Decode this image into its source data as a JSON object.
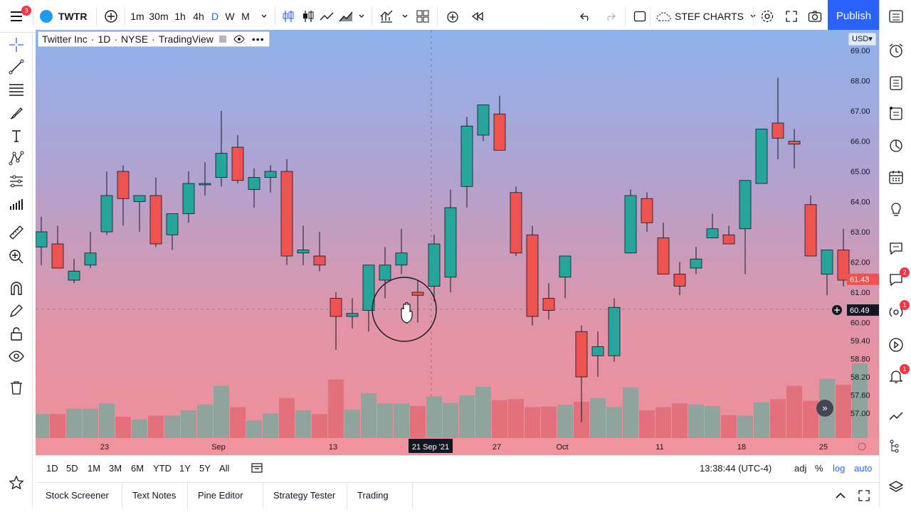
{
  "toolbar": {
    "menu_badge": "3",
    "symbol": "TWTR",
    "intervals": [
      "1m",
      "30m",
      "1h",
      "4h",
      "D",
      "W",
      "M"
    ],
    "active_interval": "D",
    "layout_name": "STEF CHARTS",
    "publish_label": "Publish"
  },
  "legend": {
    "name": "Twitter Inc",
    "interval": "1D",
    "exchange": "NYSE",
    "source": "TradingView"
  },
  "price_scale": {
    "currency": "USD",
    "labels": [
      "69.00",
      "68.00",
      "67.00",
      "66.00",
      "65.00",
      "64.00",
      "63.00",
      "62.00",
      "61.00",
      "60.00",
      "59.40",
      "58.80",
      "58.20",
      "57.60",
      "57.00"
    ],
    "last_price": "61.43",
    "cursor_price": "60.49"
  },
  "time_axis": {
    "labels": [
      "23",
      "Sep",
      "13",
      "27",
      "Oct",
      "11",
      "18",
      "25"
    ],
    "cursor_label": "21 Sep '21"
  },
  "ranges": [
    "1D",
    "5D",
    "1M",
    "3M",
    "6M",
    "YTD",
    "1Y",
    "5Y",
    "All"
  ],
  "clock": "13:38:44 (UTC-4)",
  "scale_options": [
    "adj",
    "%",
    "log",
    "auto"
  ],
  "tabs": [
    "Stock Screener",
    "Text Notes",
    "Pine Editor",
    "Strategy Tester",
    "Trading Panel"
  ],
  "right_badges": {
    "chat": "2",
    "streams": "1",
    "alerts": "1"
  },
  "colors": {
    "up": "#26a69a",
    "down": "#ef5350",
    "accent": "#2962ff"
  },
  "chart_data": {
    "type": "candlestick",
    "columns": [
      "open",
      "high",
      "low",
      "close"
    ],
    "candles": [
      [
        62.5,
        63.5,
        61.9,
        63.0
      ],
      [
        62.6,
        63.2,
        61.8,
        61.8
      ],
      [
        61.4,
        62.1,
        61.3,
        61.7
      ],
      [
        61.9,
        63.0,
        61.8,
        62.3
      ],
      [
        63.0,
        65.0,
        62.9,
        64.2
      ],
      [
        65.0,
        65.2,
        63.2,
        64.1
      ],
      [
        64.0,
        64.2,
        63.0,
        64.2
      ],
      [
        64.2,
        64.8,
        62.5,
        62.6
      ],
      [
        62.9,
        63.6,
        62.4,
        63.6
      ],
      [
        63.6,
        65.0,
        63.3,
        64.6
      ],
      [
        64.6,
        65.3,
        64.2,
        64.6
      ],
      [
        64.8,
        67.0,
        64.5,
        65.6
      ],
      [
        65.8,
        66.2,
        64.6,
        64.7
      ],
      [
        64.4,
        65.1,
        63.8,
        64.8
      ],
      [
        64.8,
        65.2,
        64.3,
        65.0
      ],
      [
        65.0,
        65.4,
        61.9,
        62.2
      ],
      [
        62.3,
        63.2,
        61.9,
        62.4
      ],
      [
        62.2,
        63.0,
        61.7,
        61.9
      ],
      [
        60.8,
        61.0,
        59.1,
        60.2
      ],
      [
        60.2,
        60.8,
        59.8,
        60.3
      ],
      [
        60.4,
        61.9,
        59.7,
        61.9
      ],
      [
        61.4,
        62.5,
        60.8,
        61.9
      ],
      [
        61.9,
        63.1,
        61.6,
        62.3
      ],
      [
        61.0,
        61.4,
        60.0,
        60.9
      ],
      [
        61.2,
        62.9,
        60.7,
        62.6
      ],
      [
        61.5,
        64.4,
        61.0,
        63.8
      ],
      [
        64.5,
        66.8,
        63.8,
        66.5
      ],
      [
        66.2,
        67.2,
        66.0,
        67.2
      ],
      [
        66.9,
        67.5,
        66.0,
        65.7
      ],
      [
        64.3,
        64.5,
        62.2,
        62.3
      ],
      [
        62.9,
        63.2,
        59.9,
        60.2
      ],
      [
        60.8,
        61.3,
        60.1,
        60.4
      ],
      [
        61.5,
        62.0,
        60.8,
        62.2
      ],
      [
        59.7,
        59.9,
        56.7,
        58.2
      ],
      [
        58.9,
        59.7,
        58.2,
        59.2
      ],
      [
        58.9,
        60.8,
        58.7,
        60.5
      ],
      [
        62.3,
        64.4,
        62.3,
        64.2
      ],
      [
        64.1,
        64.3,
        63.0,
        63.3
      ],
      [
        62.8,
        63.3,
        61.6,
        61.6
      ],
      [
        61.6,
        62.0,
        60.9,
        61.2
      ],
      [
        61.8,
        62.5,
        61.6,
        62.1
      ],
      [
        62.8,
        63.6,
        62.8,
        63.1
      ],
      [
        62.9,
        63.2,
        62.8,
        62.6
      ],
      [
        63.1,
        64.6,
        61.6,
        64.7
      ],
      [
        64.6,
        66.4,
        64.8,
        66.4
      ],
      [
        66.6,
        68.1,
        65.4,
        66.1
      ],
      [
        66.0,
        66.4,
        65.1,
        65.9
      ],
      [
        63.9,
        64.2,
        62.3,
        62.2
      ],
      [
        61.6,
        62.2,
        60.9,
        62.4
      ],
      [
        62.4,
        63.1,
        61.2,
        61.4
      ]
    ],
    "volume_levels": [
      0.45,
      0.45,
      0.55,
      0.55,
      0.65,
      0.4,
      0.35,
      0.42,
      0.42,
      0.52,
      0.63,
      0.98,
      0.58,
      0.33,
      0.46,
      0.75,
      0.52,
      0.45,
      1.1,
      0.53,
      0.84,
      0.65,
      0.65,
      0.6,
      0.78,
      0.66,
      0.8,
      0.96,
      0.71,
      0.73,
      0.58,
      0.59,
      0.62,
      0.68,
      0.75,
      0.58,
      0.95,
      0.52,
      0.58,
      0.65,
      0.63,
      0.6,
      0.43,
      0.42,
      0.67,
      0.73,
      0.98,
      0.7,
      1.11,
      1.0,
      1.4
    ],
    "y_axis_range": [
      56.6,
      69.4
    ],
    "last_close": 61.43,
    "cursor": {
      "price": 60.49,
      "date": "21 Sep '21"
    }
  }
}
